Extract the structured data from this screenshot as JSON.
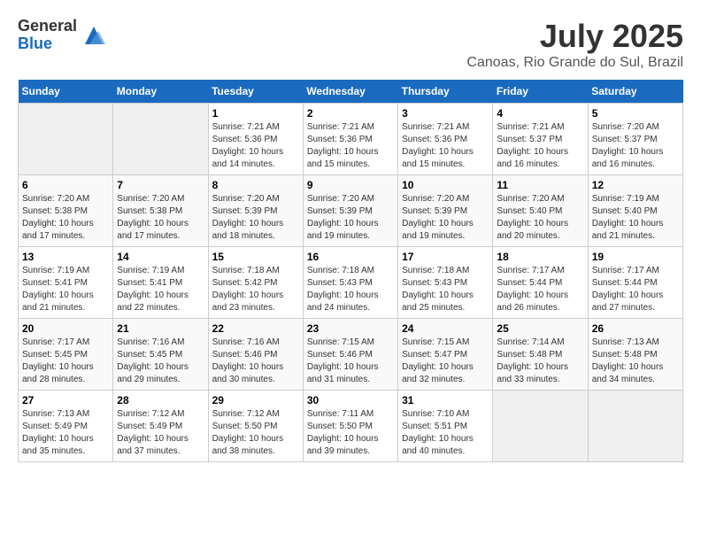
{
  "logo": {
    "general": "General",
    "blue": "Blue"
  },
  "title": "July 2025",
  "subtitle": "Canoas, Rio Grande do Sul, Brazil",
  "days_of_week": [
    "Sunday",
    "Monday",
    "Tuesday",
    "Wednesday",
    "Thursday",
    "Friday",
    "Saturday"
  ],
  "weeks": [
    [
      {
        "day": "",
        "info": ""
      },
      {
        "day": "",
        "info": ""
      },
      {
        "day": "1",
        "info": "Sunrise: 7:21 AM\nSunset: 5:36 PM\nDaylight: 10 hours and 14 minutes."
      },
      {
        "day": "2",
        "info": "Sunrise: 7:21 AM\nSunset: 5:36 PM\nDaylight: 10 hours and 15 minutes."
      },
      {
        "day": "3",
        "info": "Sunrise: 7:21 AM\nSunset: 5:36 PM\nDaylight: 10 hours and 15 minutes."
      },
      {
        "day": "4",
        "info": "Sunrise: 7:21 AM\nSunset: 5:37 PM\nDaylight: 10 hours and 16 minutes."
      },
      {
        "day": "5",
        "info": "Sunrise: 7:20 AM\nSunset: 5:37 PM\nDaylight: 10 hours and 16 minutes."
      }
    ],
    [
      {
        "day": "6",
        "info": "Sunrise: 7:20 AM\nSunset: 5:38 PM\nDaylight: 10 hours and 17 minutes."
      },
      {
        "day": "7",
        "info": "Sunrise: 7:20 AM\nSunset: 5:38 PM\nDaylight: 10 hours and 17 minutes."
      },
      {
        "day": "8",
        "info": "Sunrise: 7:20 AM\nSunset: 5:39 PM\nDaylight: 10 hours and 18 minutes."
      },
      {
        "day": "9",
        "info": "Sunrise: 7:20 AM\nSunset: 5:39 PM\nDaylight: 10 hours and 19 minutes."
      },
      {
        "day": "10",
        "info": "Sunrise: 7:20 AM\nSunset: 5:39 PM\nDaylight: 10 hours and 19 minutes."
      },
      {
        "day": "11",
        "info": "Sunrise: 7:20 AM\nSunset: 5:40 PM\nDaylight: 10 hours and 20 minutes."
      },
      {
        "day": "12",
        "info": "Sunrise: 7:19 AM\nSunset: 5:40 PM\nDaylight: 10 hours and 21 minutes."
      }
    ],
    [
      {
        "day": "13",
        "info": "Sunrise: 7:19 AM\nSunset: 5:41 PM\nDaylight: 10 hours and 21 minutes."
      },
      {
        "day": "14",
        "info": "Sunrise: 7:19 AM\nSunset: 5:41 PM\nDaylight: 10 hours and 22 minutes."
      },
      {
        "day": "15",
        "info": "Sunrise: 7:18 AM\nSunset: 5:42 PM\nDaylight: 10 hours and 23 minutes."
      },
      {
        "day": "16",
        "info": "Sunrise: 7:18 AM\nSunset: 5:43 PM\nDaylight: 10 hours and 24 minutes."
      },
      {
        "day": "17",
        "info": "Sunrise: 7:18 AM\nSunset: 5:43 PM\nDaylight: 10 hours and 25 minutes."
      },
      {
        "day": "18",
        "info": "Sunrise: 7:17 AM\nSunset: 5:44 PM\nDaylight: 10 hours and 26 minutes."
      },
      {
        "day": "19",
        "info": "Sunrise: 7:17 AM\nSunset: 5:44 PM\nDaylight: 10 hours and 27 minutes."
      }
    ],
    [
      {
        "day": "20",
        "info": "Sunrise: 7:17 AM\nSunset: 5:45 PM\nDaylight: 10 hours and 28 minutes."
      },
      {
        "day": "21",
        "info": "Sunrise: 7:16 AM\nSunset: 5:45 PM\nDaylight: 10 hours and 29 minutes."
      },
      {
        "day": "22",
        "info": "Sunrise: 7:16 AM\nSunset: 5:46 PM\nDaylight: 10 hours and 30 minutes."
      },
      {
        "day": "23",
        "info": "Sunrise: 7:15 AM\nSunset: 5:46 PM\nDaylight: 10 hours and 31 minutes."
      },
      {
        "day": "24",
        "info": "Sunrise: 7:15 AM\nSunset: 5:47 PM\nDaylight: 10 hours and 32 minutes."
      },
      {
        "day": "25",
        "info": "Sunrise: 7:14 AM\nSunset: 5:48 PM\nDaylight: 10 hours and 33 minutes."
      },
      {
        "day": "26",
        "info": "Sunrise: 7:13 AM\nSunset: 5:48 PM\nDaylight: 10 hours and 34 minutes."
      }
    ],
    [
      {
        "day": "27",
        "info": "Sunrise: 7:13 AM\nSunset: 5:49 PM\nDaylight: 10 hours and 35 minutes."
      },
      {
        "day": "28",
        "info": "Sunrise: 7:12 AM\nSunset: 5:49 PM\nDaylight: 10 hours and 37 minutes."
      },
      {
        "day": "29",
        "info": "Sunrise: 7:12 AM\nSunset: 5:50 PM\nDaylight: 10 hours and 38 minutes."
      },
      {
        "day": "30",
        "info": "Sunrise: 7:11 AM\nSunset: 5:50 PM\nDaylight: 10 hours and 39 minutes."
      },
      {
        "day": "31",
        "info": "Sunrise: 7:10 AM\nSunset: 5:51 PM\nDaylight: 10 hours and 40 minutes."
      },
      {
        "day": "",
        "info": ""
      },
      {
        "day": "",
        "info": ""
      }
    ]
  ]
}
